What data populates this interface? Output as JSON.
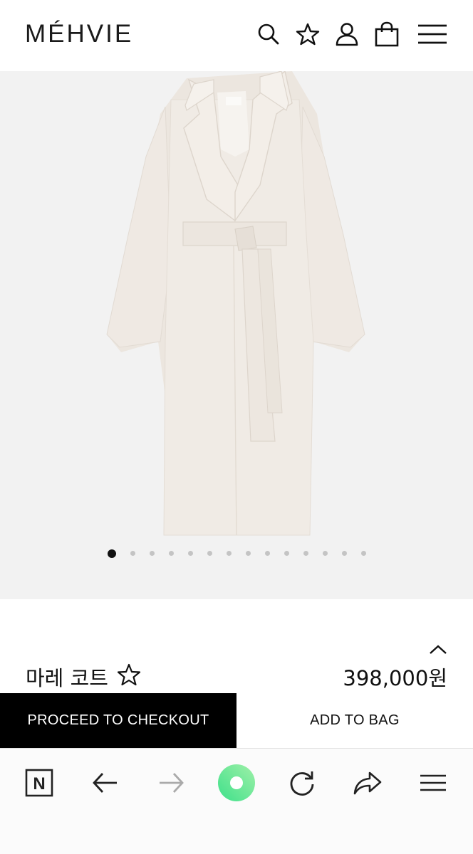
{
  "header": {
    "logo": "MÉHVIE",
    "icons": [
      "search-icon",
      "star-icon",
      "user-icon",
      "shopping-bag-icon",
      "menu-icon"
    ]
  },
  "gallery": {
    "total_images": 14,
    "active_index": 0,
    "tag_text": "MÉHVIE"
  },
  "product": {
    "name": "마레 코트",
    "price": "398,000원"
  },
  "actions": {
    "checkout_label": "PROCEED TO CHECKOUT",
    "add_to_bag_label": "ADD TO BAG"
  },
  "browser": {
    "icons": [
      "n-home-icon",
      "back-arrow-icon",
      "forward-arrow-icon",
      "green-dot-icon",
      "reload-icon",
      "share-icon",
      "menu-icon"
    ],
    "brand_letter": "N"
  },
  "colors": {
    "checkout_bg": "#000000",
    "gallery_bg": "#f2f2f2",
    "green_gradient_start": "#3ee08a",
    "green_gradient_end": "#9ff0a8"
  }
}
